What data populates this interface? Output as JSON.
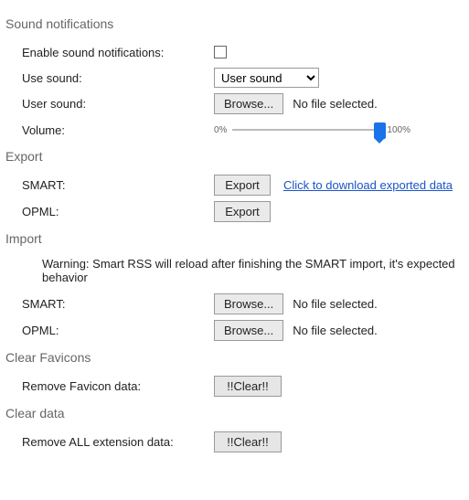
{
  "sound": {
    "title": "Sound notifications",
    "enable_label": "Enable sound notifications:",
    "use_label": "Use sound:",
    "use_value": "User sound",
    "user_label": "User sound:",
    "browse": "Browse...",
    "file_status": "No file selected.",
    "volume_label": "Volume:",
    "vol_min": "0%",
    "vol_max": "100%"
  },
  "export": {
    "title": "Export",
    "smart_label": "SMART:",
    "opml_label": "OPML:",
    "export_btn": "Export",
    "download_link": "Click to download exported data"
  },
  "import": {
    "title": "Import",
    "warning": "Warning: Smart RSS will reload after finishing the SMART import, it's expected behavior",
    "smart_label": "SMART:",
    "opml_label": "OPML:",
    "browse": "Browse...",
    "file_status": "No file selected."
  },
  "clear_favicons": {
    "title": "Clear Favicons",
    "label": "Remove Favicon data:",
    "btn": "!!Clear!!"
  },
  "clear_data": {
    "title": "Clear data",
    "label": "Remove ALL extension data:",
    "btn": "!!Clear!!"
  }
}
